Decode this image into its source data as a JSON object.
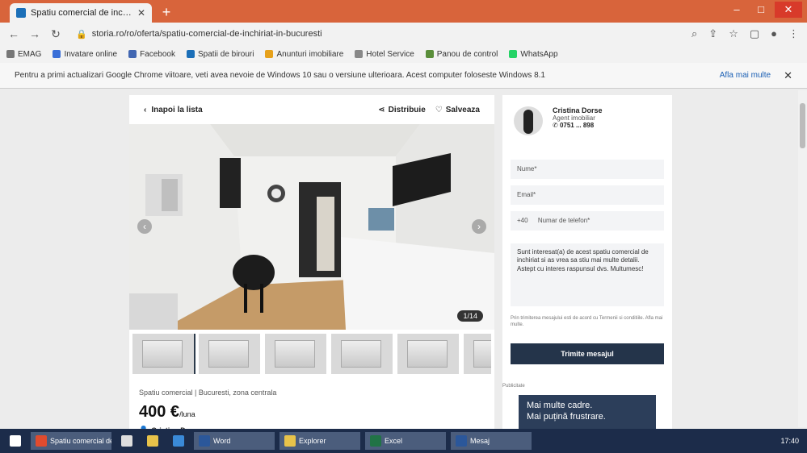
{
  "browser": {
    "tab_title": "Spatiu comercial de inchiriat",
    "tab_close": "✕",
    "new_tab": "+",
    "url": "storia.ro/ro/oferta/spatiu-comercial-de-inchiriat-in-bucuresti",
    "win": {
      "min": "–",
      "max": "□",
      "close": "✕"
    },
    "bookmarks": [
      "EMAG",
      "Invatare online",
      "Facebook",
      "Spatii de birouri",
      "Anunturi imobiliare",
      "Hotel Service",
      "Panou de control",
      "WhatsApp"
    ],
    "infobar_msg": "Pentru a primi actualizari Google Chrome viitoare, veti avea nevoie de Windows 10 sau o versiune ulterioara. Acest computer foloseste Windows 8.1",
    "infobar_more": "Afla mai multe",
    "infobar_close": "✕"
  },
  "listing": {
    "back": "Inapoi la lista",
    "share": "Distribuie",
    "save": "Salveaza",
    "photo_count": "1/14",
    "summary": "Spatiu comercial | Bucuresti, zona centrala",
    "price": "400 €",
    "price_unit": "/luna",
    "agency": "Cristina Dorse"
  },
  "contact": {
    "name": "Cristina Dorse",
    "role": "Agent imobiliar",
    "phone": "0751 ... 898",
    "name_ph": "Nume*",
    "email_ph": "Email*",
    "phone_prefix": "+40",
    "phone_ph": "Numar de telefon*",
    "message": "Sunt interesat(a) de acest spatiu comercial de inchiriat si as vrea sa stiu mai multe detalii. Astept cu interes raspunsul dvs. Multumesc!",
    "terms": "Prin trimiterea mesajului esti de acord cu Termenii si conditiile. Afla mai multe.",
    "send": "Trimite mesajul",
    "ad_label": "Publicitate",
    "ad_text": "Mai multe cadre.\nMai puțină frustrare."
  },
  "taskbar": {
    "items": [
      "Start",
      "Chrome",
      "Explorer",
      "Word",
      "Excel",
      "Mesaj",
      "Paint"
    ],
    "clock": "17:40"
  },
  "colors": {
    "chrome_accent": "#d8643b",
    "send_button": "#24344a",
    "ad_bg": "#2c3e5a",
    "taskbar": "#1c2c4a"
  }
}
